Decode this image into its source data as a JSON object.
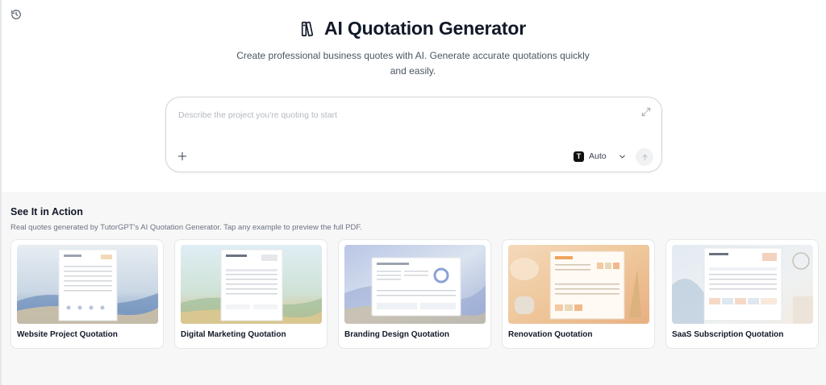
{
  "header": {
    "title": "AI Quotation Generator",
    "subtitle": "Create professional business quotes with AI. Generate accurate quotations quickly and easily."
  },
  "prompt": {
    "placeholder": "Describe the project you're quoting to start",
    "value": "",
    "model_badge": "T",
    "model_label": "Auto"
  },
  "examples": {
    "heading": "See It in Action",
    "description": "Real quotes generated by TutorGPT's AI Quotation Generator. Tap any example to preview the full PDF.",
    "cards": [
      {
        "label": "Website Project Quotation"
      },
      {
        "label": "Digital Marketing Quotation"
      },
      {
        "label": "Branding Design Quotation"
      },
      {
        "label": "Renovation Quotation"
      },
      {
        "label": "SaaS Subscription Quotation"
      }
    ]
  },
  "icons": {
    "history": "history-icon",
    "logo": "books-icon",
    "expand": "expand-icon",
    "add": "plus-icon",
    "dropdown": "chevron-down-icon",
    "send": "arrow-up-icon"
  },
  "colors": {
    "text": "#111827",
    "muted": "#6b7280",
    "section_bg": "#f7f7f8",
    "border": "#e5e7eb"
  }
}
